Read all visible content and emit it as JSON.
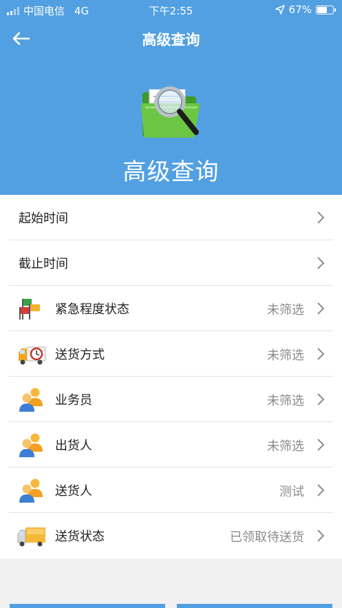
{
  "status": {
    "carrier": "中国电信",
    "network": "4G",
    "time": "下午2:55",
    "battery": "67%",
    "battery_level": 67
  },
  "nav": {
    "title": "高级查询"
  },
  "hero": {
    "title": "高级查询"
  },
  "rows": [
    {
      "label": "起始时间",
      "value": "",
      "icon": "none"
    },
    {
      "label": "截止时间",
      "value": "",
      "icon": "none"
    },
    {
      "label": "紧急程度状态",
      "value": "未筛选",
      "icon": "flags-icon"
    },
    {
      "label": "送货方式",
      "value": "未筛选",
      "icon": "delivery-truck-clock-icon"
    },
    {
      "label": "业务员",
      "value": "未筛选",
      "icon": "users-icon"
    },
    {
      "label": "出货人",
      "value": "未筛选",
      "icon": "users-icon"
    },
    {
      "label": "送货人",
      "value": "测试",
      "icon": "users-icon"
    },
    {
      "label": "送货状态",
      "value": "已领取待送货",
      "icon": "delivery-truck-icon"
    }
  ],
  "colors": {
    "header": "#52a0e2",
    "row_text": "#222222",
    "value_text": "#8a8a8a"
  }
}
